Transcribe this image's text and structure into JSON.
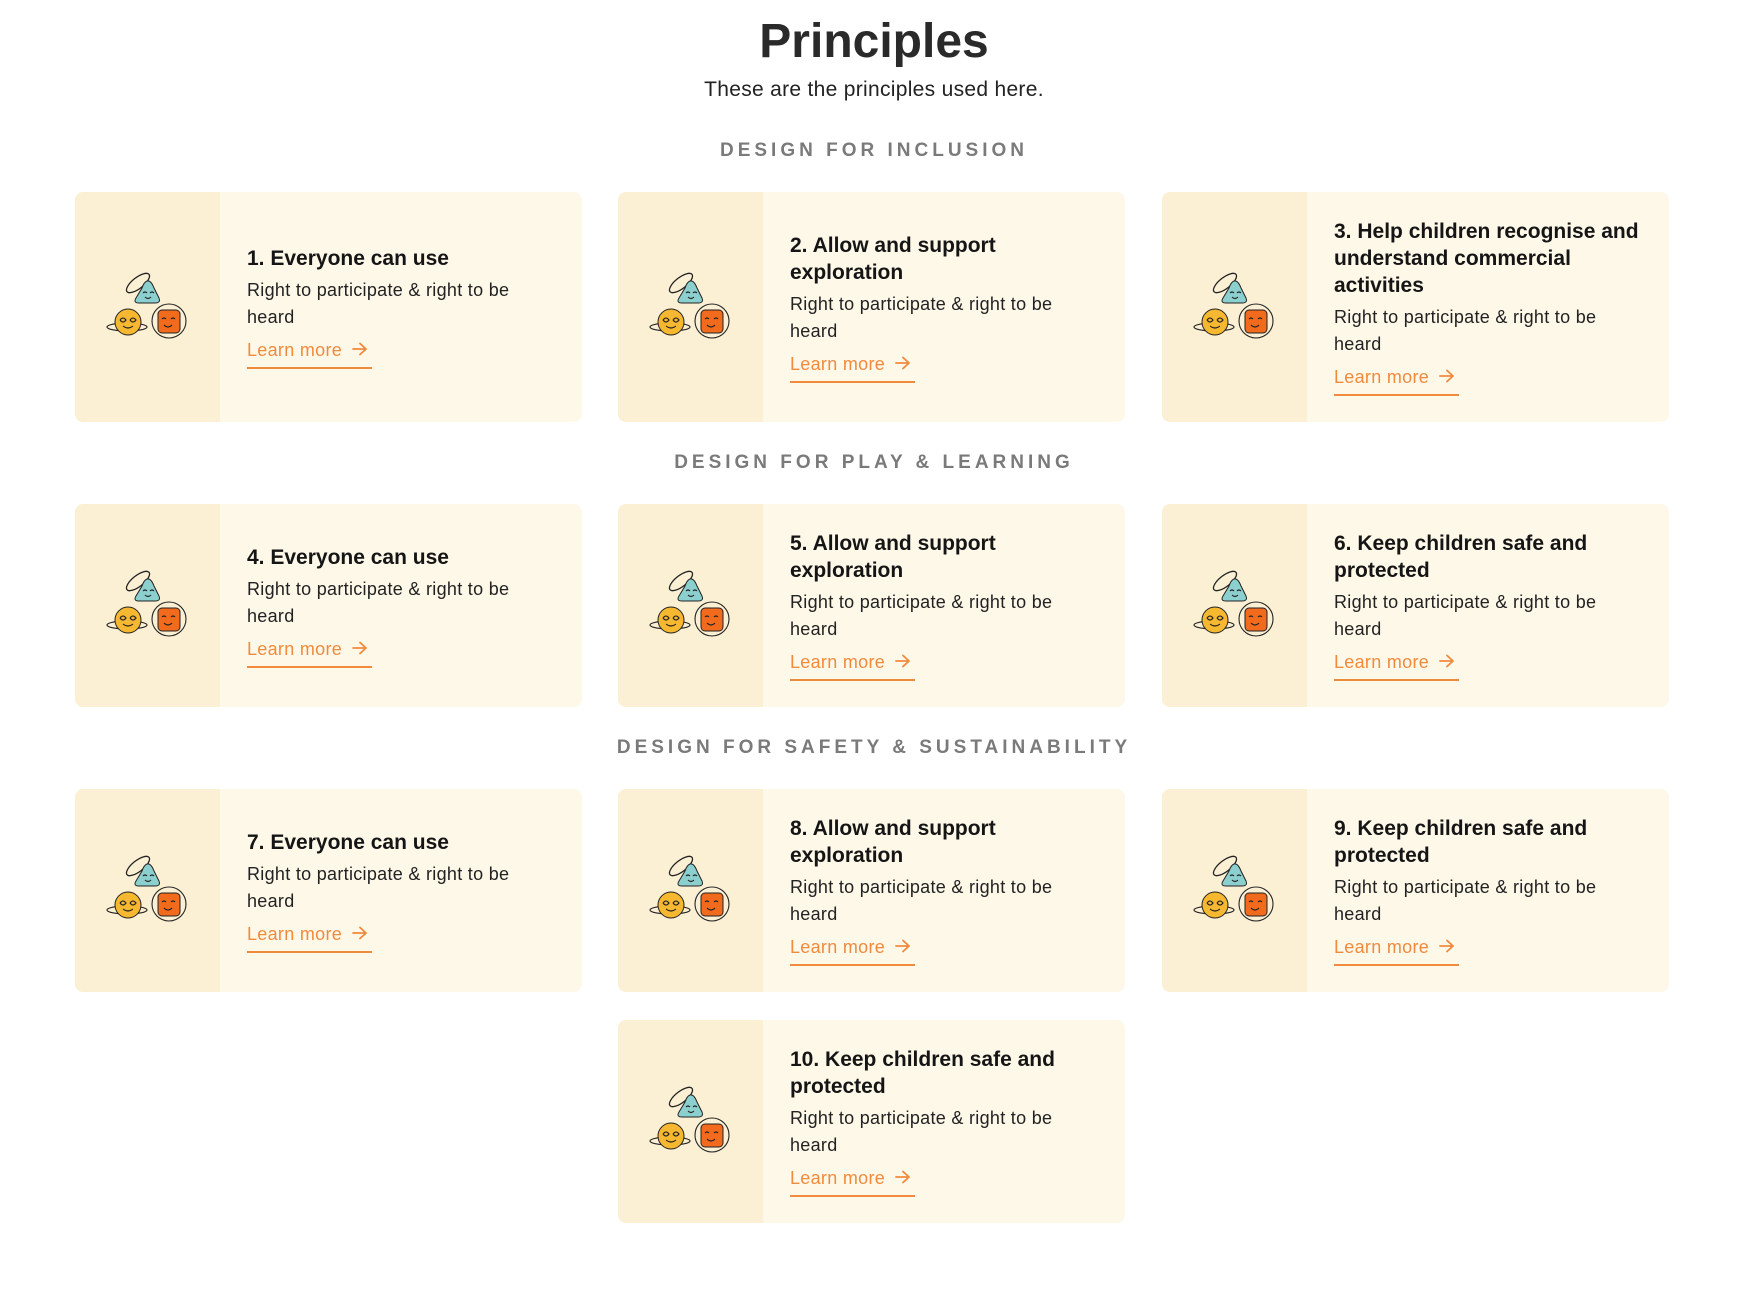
{
  "header": {
    "title": "Principles",
    "subtitle": "These are the principles used here."
  },
  "sections": [
    {
      "title": "DESIGN FOR INCLUSION",
      "cards": [
        {
          "title": "1. Everyone can use",
          "description": "Right to participate & right to be heard",
          "link": "Learn more"
        },
        {
          "title": "2. Allow and support exploration",
          "description": "Right to participate & right to be heard",
          "link": "Learn more"
        },
        {
          "title": "3. Help children recognise and understand commercial activities",
          "description": "Right to participate & right to be heard",
          "link": "Learn more"
        }
      ]
    },
    {
      "title": "DESIGN FOR PLAY & LEARNING",
      "cards": [
        {
          "title": "4. Everyone can use",
          "description": "Right to participate & right to be heard",
          "link": "Learn more"
        },
        {
          "title": "5. Allow and support exploration",
          "description": "Right to participate & right to be heard",
          "link": "Learn more"
        },
        {
          "title": "6. Keep children safe and protected",
          "description": "Right to participate & right to be heard",
          "link": "Learn more"
        }
      ]
    },
    {
      "title": "DESIGN FOR SAFETY & SUSTAINABILITY",
      "cards": [
        {
          "title": "7. Everyone can use",
          "description": "Right to participate & right to be heard",
          "link": "Learn more"
        },
        {
          "title": "8. Allow and support exploration",
          "description": "Right to participate & right to be heard",
          "link": "Learn more"
        },
        {
          "title": "9. Keep children safe and protected",
          "description": "Right to participate & right to be heard",
          "link": "Learn more"
        },
        {
          "title": "10. Keep children safe and protected",
          "description": "Right to participate & right to be heard",
          "link": "Learn more"
        }
      ]
    }
  ],
  "colors": {
    "accent": "#f08a3c",
    "card_bg": "#fef8e9",
    "illustration_bg": "#fcf0d4",
    "section_title": "#7a7a7a"
  },
  "icons": {
    "illustration": "three-characters-illustration",
    "arrow": "arrow-right-icon"
  }
}
